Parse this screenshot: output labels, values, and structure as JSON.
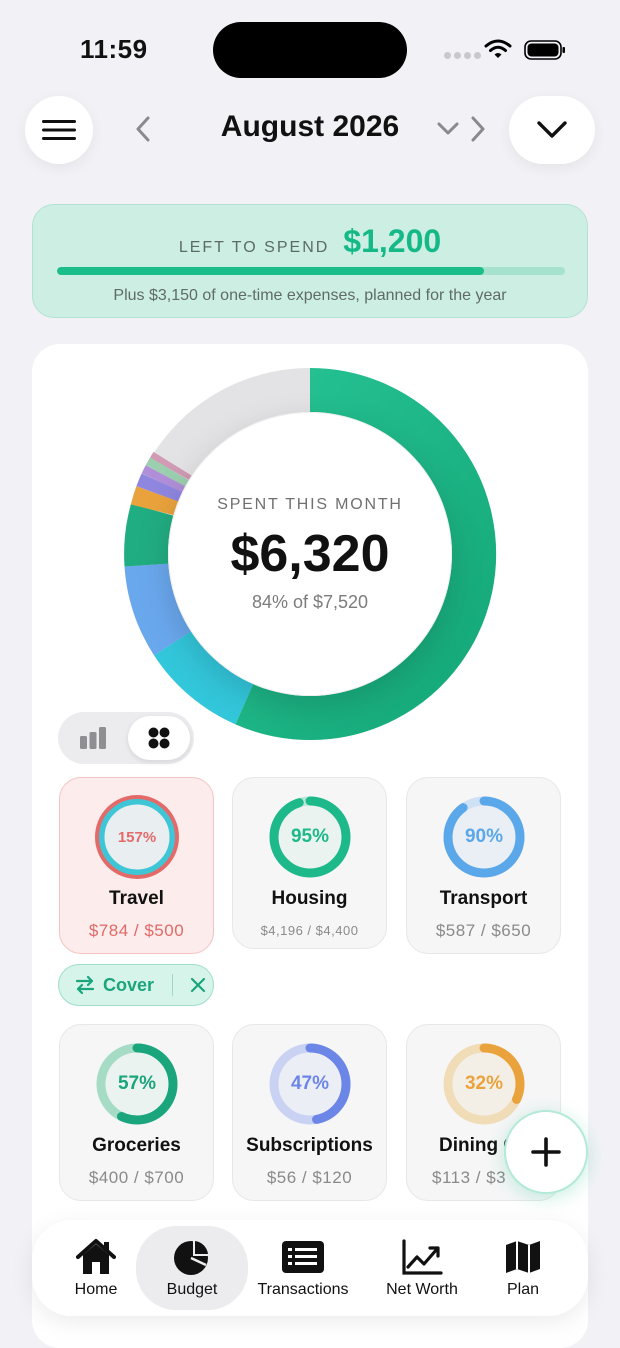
{
  "status": {
    "time": "11:59"
  },
  "header": {
    "month": "August 2026"
  },
  "left_to_spend": {
    "label": "LEFT TO SPEND",
    "value": "$1,200",
    "progress": 0.84,
    "note": "Plus $3,150 of one-time expenses, planned for the year"
  },
  "summary": {
    "label": "SPENT THIS MONTH",
    "value": "$6,320",
    "sub": "84% of $7,520",
    "ring_fraction": 0.84
  },
  "categories": [
    {
      "name": "Travel",
      "pct": "157%",
      "progress": 1.57,
      "amount": "$784 / $500",
      "color": "#e46a6a",
      "status": "over"
    },
    {
      "name": "Housing",
      "pct": "95%",
      "progress": 0.95,
      "amount": "$4,196 / $4,400",
      "color": "#1db98b"
    },
    {
      "name": "Transport",
      "pct": "90%",
      "progress": 0.9,
      "amount": "$587 / $650",
      "color": "#5aa7ea"
    },
    {
      "name": "Groceries",
      "pct": "57%",
      "progress": 0.57,
      "amount": "$400 / $700",
      "color": "#1aa57c"
    },
    {
      "name": "Subscriptions",
      "pct": "47%",
      "progress": 0.47,
      "amount": "$56 / $120",
      "color": "#6b86e6"
    },
    {
      "name": "Dining C",
      "pct": "32%",
      "progress": 0.32,
      "amount": "$113 / $3",
      "color": "#eaa33c"
    }
  ],
  "cover": {
    "label": "Cover"
  },
  "tabs": [
    {
      "label": "Home",
      "icon": "home-icon"
    },
    {
      "label": "Budget",
      "icon": "pie-chart-icon",
      "active": true
    },
    {
      "label": "Transactions",
      "icon": "list-icon"
    },
    {
      "label": "Net Worth",
      "icon": "trend-icon"
    },
    {
      "label": "Plan",
      "icon": "map-icon"
    }
  ],
  "colors": {
    "accent": "#1bbd8a",
    "over": "#e46a6a",
    "background": "#f2f2f6"
  }
}
